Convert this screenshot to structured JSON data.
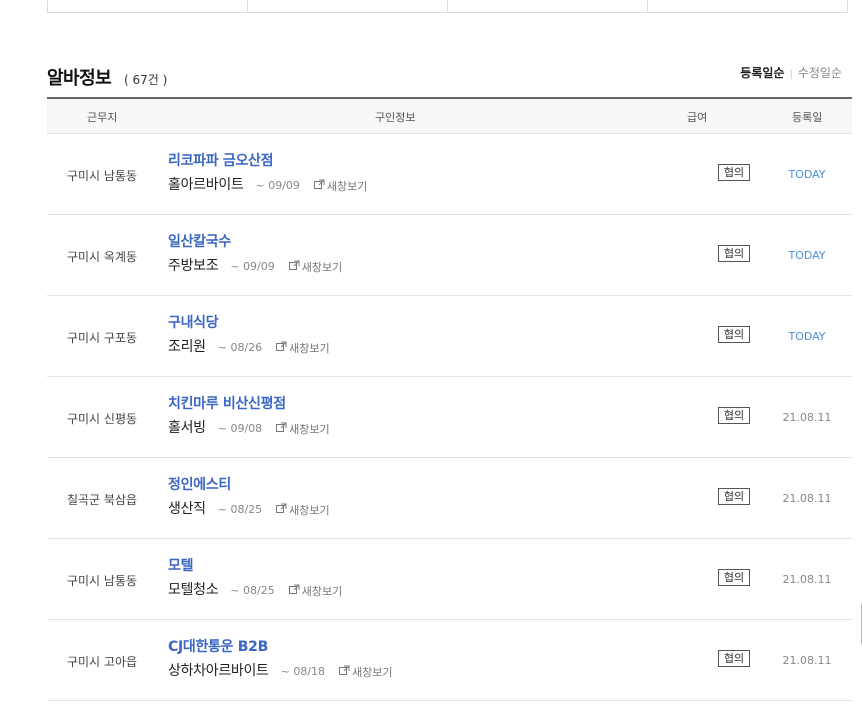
{
  "section": {
    "title": "알바정보",
    "count": "( 67건 )",
    "sort_active": "등록일순",
    "sort_other": "수정일순"
  },
  "columns": {
    "location": "근무지",
    "info": "구인정보",
    "pay": "급여",
    "date": "등록일"
  },
  "rows": [
    {
      "location": "구미시 남통동",
      "company": "리코파파 금오산점",
      "job": "홀아르바이트",
      "deadline": "~ 09/09",
      "new_window": "새창보기",
      "pay": "협의",
      "date": "TODAY"
    },
    {
      "location": "구미시 옥계동",
      "company": "일산칼국수",
      "job": "주방보조",
      "deadline": "~ 09/09",
      "new_window": "새창보기",
      "pay": "협의",
      "date": "TODAY"
    },
    {
      "location": "구미시 구포동",
      "company": "구내식당",
      "job": "조리원",
      "deadline": "~ 08/26",
      "new_window": "새창보기",
      "pay": "협의",
      "date": "TODAY"
    },
    {
      "location": "구미시 신평동",
      "company": "치킨마루 비산신평점",
      "job": "홀서빙",
      "deadline": "~ 09/08",
      "new_window": "새창보기",
      "pay": "협의",
      "date": "21.08.11"
    },
    {
      "location": "칠곡군 북삼읍",
      "company": "정인에스티",
      "job": "생산직",
      "deadline": "~ 08/25",
      "new_window": "새창보기",
      "pay": "협의",
      "date": "21.08.11"
    },
    {
      "location": "구미시 남통동",
      "company": "모텔",
      "job": "모텔청소",
      "deadline": "~ 08/25",
      "new_window": "새창보기",
      "pay": "협의",
      "date": "21.08.11"
    },
    {
      "location": "구미시 고아읍",
      "company": "CJ대한통운 B2B",
      "job": "상하차아르바이트",
      "deadline": "~ 08/18",
      "new_window": "새창보기",
      "pay": "협의",
      "date": "21.08.11"
    }
  ],
  "colors": {
    "company_link": "#3a66c4",
    "today": "#4a90d9"
  }
}
